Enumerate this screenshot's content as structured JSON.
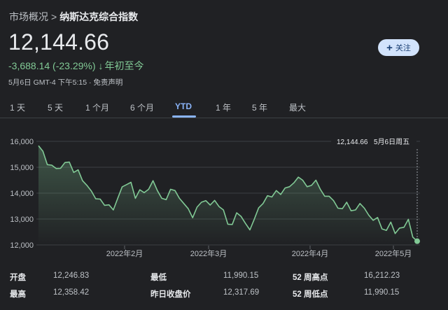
{
  "breadcrumb": {
    "parent": "市场概况",
    "separator": ">",
    "current": "纳斯达克综合指数"
  },
  "quote": {
    "price": "12,144.66",
    "change": "-3,688.14 (-23.29%)",
    "change_arrow": "↓",
    "period": "年初至今",
    "meta": "5月6日 GMT-4 下午5:15 · 免责声明"
  },
  "follow_button": {
    "icon": "plus-icon",
    "label": "关注",
    "color": "#d2e3fc"
  },
  "ranges": {
    "tabs": [
      "1 天",
      "5 天",
      "1 个月",
      "6 个月",
      "YTD",
      "1 年",
      "5 年",
      "最大"
    ],
    "active": "YTD"
  },
  "chart_data": {
    "type": "area",
    "line_color": "#81c995",
    "ylim": [
      12000,
      16000
    ],
    "y_ticks": [
      "16,000",
      "15,000",
      "14,000",
      "13,000",
      "12,000"
    ],
    "x_tick_labels": [
      "2022年2月",
      "2022年3月",
      "2022年4月",
      "2022年5月"
    ],
    "tooltip": {
      "value": "12,144.66",
      "date": "5月6日周五"
    },
    "grid": true,
    "series": [
      {
        "values": [
          15832,
          15620,
          15100,
          15080,
          14950,
          14960,
          15180,
          15200,
          14800,
          14900,
          14480,
          14300,
          14080,
          13780,
          13770,
          13530,
          13550,
          13350,
          13800,
          14240,
          14330,
          14420,
          13800,
          14130,
          14020,
          14150,
          14480,
          14100,
          13800,
          13750,
          14150,
          14100,
          13800,
          13600,
          13400,
          13050,
          13460,
          13650,
          13710,
          13540,
          13720,
          13480,
          13350,
          12800,
          12790,
          13240,
          13100,
          12830,
          12580,
          12990,
          13430,
          13600,
          13900,
          13850,
          14100,
          13950,
          14200,
          14250,
          14400,
          14620,
          14500,
          14250,
          14300,
          14500,
          14150,
          13880,
          13880,
          13710,
          13420,
          13400,
          13650,
          13320,
          13350,
          13600,
          13420,
          13150,
          12950,
          13060,
          12620,
          12560,
          12880,
          12440,
          12650,
          12680,
          12990,
          12300,
          12144
        ]
      }
    ]
  },
  "stats": {
    "open_label": "开盘",
    "open_value": "12,246.83",
    "high_label": "最高",
    "high_value": "12,358.42",
    "low_label": "最低",
    "low_value": "11,990.15",
    "prev_close_label": "昨日收盘价",
    "prev_close_value": "12,317.69",
    "wk52_high_label": "52 周高点",
    "wk52_high_value": "16,212.23",
    "wk52_low_label": "52 周低点",
    "wk52_low_value": "11,990.15"
  }
}
